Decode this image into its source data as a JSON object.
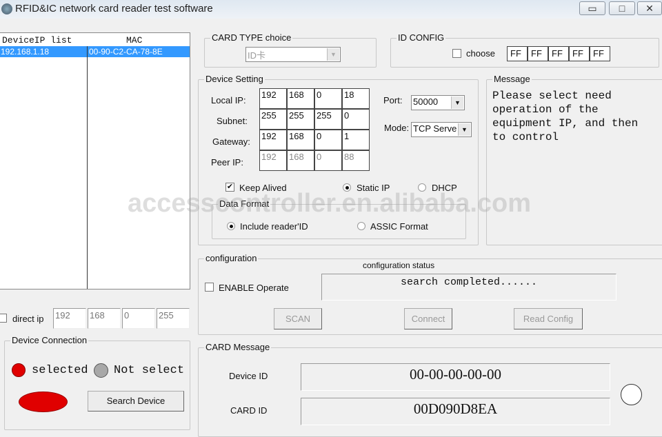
{
  "window": {
    "title": "RFID&IC network card reader test software",
    "minimize": "▭",
    "maximize": "□",
    "close": "✕"
  },
  "device_list": {
    "headers": [
      "DeviceIP list",
      "MAC"
    ],
    "rows": [
      {
        "ip": "192.168.1.18",
        "mac": "00-90-C2-CA-78-8E"
      }
    ]
  },
  "direct_ip": {
    "label": "direct ip",
    "checked": false,
    "octets": [
      "192",
      "168",
      "0",
      "255"
    ]
  },
  "device_connection": {
    "title": "Device Connection",
    "selected_label": "selected",
    "not_selected_label": "Not select",
    "search_button": "Search Device",
    "colors": {
      "selected": "#e00000",
      "not_selected": "#a8a8a8"
    }
  },
  "card_type": {
    "title": "CARD TYPE choice",
    "value": "ID卡"
  },
  "id_config": {
    "title": "ID CONFIG",
    "choose_label": "choose",
    "checked": false,
    "bytes": [
      "FF",
      "FF",
      "FF",
      "FF",
      "FF"
    ]
  },
  "device_setting": {
    "title": "Device Setting",
    "rows": [
      {
        "label": "Local IP:",
        "octets": [
          "192",
          "168",
          "0",
          "18"
        ]
      },
      {
        "label": "Subnet:",
        "octets": [
          "255",
          "255",
          "255",
          "0"
        ]
      },
      {
        "label": "Gateway:",
        "octets": [
          "192",
          "168",
          "0",
          "1"
        ]
      },
      {
        "label": "Peer IP:",
        "octets": [
          "192",
          "168",
          "0",
          "88"
        ]
      }
    ],
    "port_label": "Port:",
    "port_value": "50000",
    "mode_label": "Mode:",
    "mode_value": "TCP Serve",
    "keep_alived": "Keep Alived",
    "static_ip": "Static IP",
    "dhcp": "DHCP",
    "data_format": {
      "title": "Data Format",
      "include": "Include reader'ID",
      "assic": "ASSIC Format"
    }
  },
  "message": {
    "title": "Message",
    "text": "Please select need operation of the equipment IP, and then to control"
  },
  "configuration": {
    "title": "configuration",
    "status_title": "configuration status",
    "enable_label": "ENABLE Operate",
    "status_text": "search completed......",
    "scan": "SCAN",
    "connect": "Connect",
    "read_config": "Read Config"
  },
  "card_message": {
    "title": "CARD Message",
    "device_id_label": "Device ID",
    "device_id": "00-00-00-00-00",
    "card_id_label": "CARD ID",
    "card_id": "00D090D8EA"
  },
  "watermark": "accesscontroller.en.alibaba.com"
}
